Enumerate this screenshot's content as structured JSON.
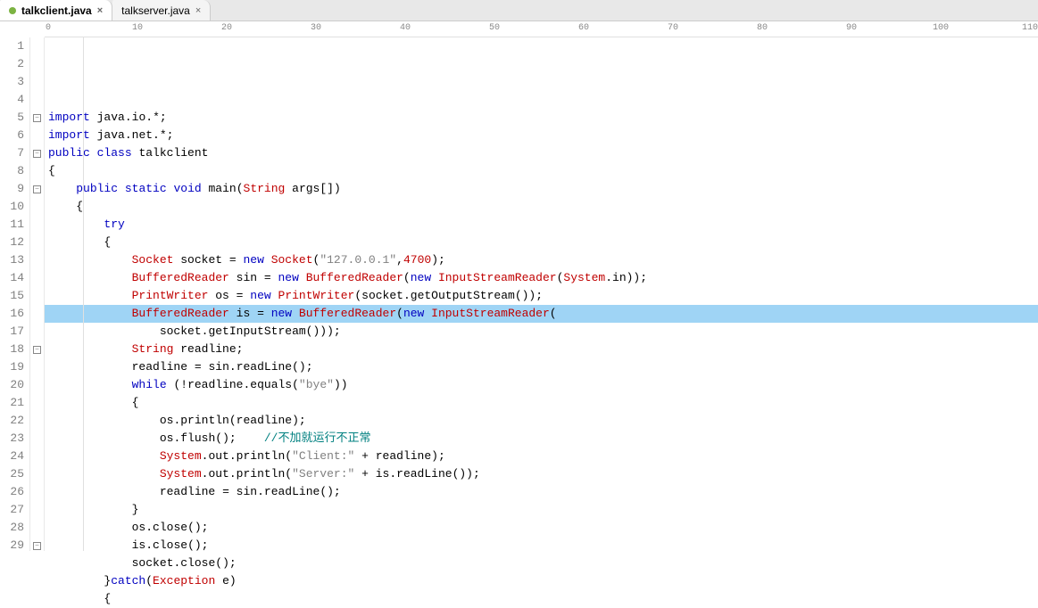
{
  "tabs": [
    {
      "label": "talkclient.java",
      "active": true,
      "modified": true
    },
    {
      "label": "talkserver.java",
      "active": false,
      "modified": false
    }
  ],
  "ruler": {
    "marks": [
      0,
      10,
      20,
      30,
      40,
      50,
      60,
      70,
      80,
      90,
      100,
      110
    ]
  },
  "code": {
    "lines": [
      {
        "n": 1,
        "fold": "",
        "hl": false,
        "tokens": []
      },
      {
        "n": 2,
        "fold": "",
        "hl": false,
        "tokens": [
          [
            "kw",
            "import"
          ],
          [
            "punc",
            " java"
          ],
          [
            "punc",
            "."
          ],
          [
            "ident",
            "io"
          ],
          [
            "punc",
            "."
          ],
          [
            "punc",
            "*"
          ],
          [
            "punc",
            ";"
          ]
        ]
      },
      {
        "n": 3,
        "fold": "",
        "hl": false,
        "tokens": [
          [
            "kw",
            "import"
          ],
          [
            "punc",
            " java"
          ],
          [
            "punc",
            "."
          ],
          [
            "ident",
            "net"
          ],
          [
            "punc",
            "."
          ],
          [
            "punc",
            "*"
          ],
          [
            "punc",
            ";"
          ]
        ]
      },
      {
        "n": 4,
        "fold": "",
        "hl": false,
        "tokens": [
          [
            "kw",
            "public"
          ],
          [
            "punc",
            " "
          ],
          [
            "kw",
            "class"
          ],
          [
            "punc",
            " "
          ],
          [
            "ident",
            "talkclient"
          ]
        ]
      },
      {
        "n": 5,
        "fold": "-",
        "hl": false,
        "tokens": [
          [
            "punc",
            "{"
          ]
        ]
      },
      {
        "n": 6,
        "fold": "",
        "hl": false,
        "tokens": [
          [
            "punc",
            "    "
          ],
          [
            "kw",
            "public"
          ],
          [
            "punc",
            " "
          ],
          [
            "kw",
            "static"
          ],
          [
            "punc",
            " "
          ],
          [
            "kw",
            "void"
          ],
          [
            "punc",
            " "
          ],
          [
            "ident",
            "main"
          ],
          [
            "punc",
            "("
          ],
          [
            "type",
            "String"
          ],
          [
            "punc",
            " args"
          ],
          [
            "punc",
            "[])"
          ]
        ]
      },
      {
        "n": 7,
        "fold": "-",
        "hl": false,
        "tokens": [
          [
            "punc",
            "    {"
          ]
        ]
      },
      {
        "n": 8,
        "fold": "",
        "hl": false,
        "tokens": [
          [
            "punc",
            "        "
          ],
          [
            "kw",
            "try"
          ]
        ]
      },
      {
        "n": 9,
        "fold": "-",
        "hl": false,
        "tokens": [
          [
            "punc",
            "        {"
          ]
        ]
      },
      {
        "n": 10,
        "fold": "",
        "hl": false,
        "tokens": [
          [
            "punc",
            "            "
          ],
          [
            "type",
            "Socket"
          ],
          [
            "punc",
            " socket "
          ],
          [
            "punc",
            "="
          ],
          [
            "punc",
            " "
          ],
          [
            "kw",
            "new"
          ],
          [
            "punc",
            " "
          ],
          [
            "type",
            "Socket"
          ],
          [
            "punc",
            "("
          ],
          [
            "str",
            "\"127.0.0.1\""
          ],
          [
            "punc",
            ","
          ],
          [
            "num",
            "4700"
          ],
          [
            "punc",
            ")"
          ],
          [
            "punc",
            ";"
          ]
        ]
      },
      {
        "n": 11,
        "fold": "",
        "hl": false,
        "tokens": [
          [
            "punc",
            "            "
          ],
          [
            "type",
            "BufferedReader"
          ],
          [
            "punc",
            " sin "
          ],
          [
            "punc",
            "="
          ],
          [
            "punc",
            " "
          ],
          [
            "kw",
            "new"
          ],
          [
            "punc",
            " "
          ],
          [
            "type",
            "BufferedReader"
          ],
          [
            "punc",
            "("
          ],
          [
            "kw",
            "new"
          ],
          [
            "punc",
            " "
          ],
          [
            "type",
            "InputStreamReader"
          ],
          [
            "punc",
            "("
          ],
          [
            "type",
            "System"
          ],
          [
            "punc",
            "."
          ],
          [
            "ident",
            "in"
          ],
          [
            "punc",
            "));"
          ]
        ]
      },
      {
        "n": 12,
        "fold": "",
        "hl": false,
        "tokens": [
          [
            "punc",
            "            "
          ],
          [
            "type",
            "PrintWriter"
          ],
          [
            "punc",
            " os "
          ],
          [
            "punc",
            "="
          ],
          [
            "punc",
            " "
          ],
          [
            "kw",
            "new"
          ],
          [
            "punc",
            " "
          ],
          [
            "type",
            "PrintWriter"
          ],
          [
            "punc",
            "("
          ],
          [
            "ident",
            "socket"
          ],
          [
            "punc",
            "."
          ],
          [
            "ident",
            "getOutputStream"
          ],
          [
            "punc",
            "());"
          ]
        ]
      },
      {
        "n": 13,
        "fold": "",
        "hl": true,
        "tokens": [
          [
            "punc",
            "            "
          ],
          [
            "type",
            "BufferedReader"
          ],
          [
            "punc",
            " is "
          ],
          [
            "punc",
            "="
          ],
          [
            "punc",
            " "
          ],
          [
            "kw",
            "new"
          ],
          [
            "punc",
            " "
          ],
          [
            "type",
            "BufferedReader"
          ],
          [
            "punc",
            "("
          ],
          [
            "kw",
            "new"
          ],
          [
            "punc",
            " "
          ],
          [
            "type",
            "InputStreamReader"
          ],
          [
            "punc",
            "("
          ]
        ]
      },
      {
        "n": 14,
        "fold": "",
        "hl": false,
        "tokens": [
          [
            "punc",
            "                "
          ],
          [
            "ident",
            "socket"
          ],
          [
            "punc",
            "."
          ],
          [
            "ident",
            "getInputStream"
          ],
          [
            "punc",
            "()));"
          ]
        ]
      },
      {
        "n": 15,
        "fold": "",
        "hl": false,
        "tokens": [
          [
            "punc",
            "            "
          ],
          [
            "type",
            "String"
          ],
          [
            "punc",
            " readline;"
          ]
        ]
      },
      {
        "n": 16,
        "fold": "",
        "hl": false,
        "tokens": [
          [
            "punc",
            "            "
          ],
          [
            "ident",
            "readline"
          ],
          [
            "punc",
            " "
          ],
          [
            "punc",
            "="
          ],
          [
            "punc",
            " sin"
          ],
          [
            "punc",
            "."
          ],
          [
            "ident",
            "readLine"
          ],
          [
            "punc",
            "();"
          ]
        ]
      },
      {
        "n": 17,
        "fold": "",
        "hl": false,
        "tokens": [
          [
            "punc",
            "            "
          ],
          [
            "kw",
            "while"
          ],
          [
            "punc",
            " ("
          ],
          [
            "punc",
            "!"
          ],
          [
            "ident",
            "readline"
          ],
          [
            "punc",
            "."
          ],
          [
            "ident",
            "equals"
          ],
          [
            "punc",
            "("
          ],
          [
            "str",
            "\"bye\""
          ],
          [
            "punc",
            "))"
          ]
        ]
      },
      {
        "n": 18,
        "fold": "-",
        "hl": false,
        "tokens": [
          [
            "punc",
            "            {"
          ]
        ]
      },
      {
        "n": 19,
        "fold": "",
        "hl": false,
        "tokens": [
          [
            "punc",
            "                "
          ],
          [
            "ident",
            "os"
          ],
          [
            "punc",
            "."
          ],
          [
            "ident",
            "println"
          ],
          [
            "punc",
            "("
          ],
          [
            "ident",
            "readline"
          ],
          [
            "punc",
            ")"
          ],
          [
            "punc",
            ";"
          ]
        ]
      },
      {
        "n": 20,
        "fold": "",
        "hl": false,
        "cursor": true,
        "tokens": [
          [
            "punc",
            "                "
          ],
          [
            "ident",
            "os"
          ],
          [
            "punc",
            "."
          ],
          [
            "ident",
            "flush"
          ],
          [
            "punc",
            "();    "
          ],
          [
            "cmt",
            "//不加就运行不正常"
          ]
        ]
      },
      {
        "n": 21,
        "fold": "",
        "hl": false,
        "tokens": [
          [
            "punc",
            "                "
          ],
          [
            "type",
            "System"
          ],
          [
            "punc",
            "."
          ],
          [
            "ident",
            "out"
          ],
          [
            "punc",
            "."
          ],
          [
            "ident",
            "println"
          ],
          [
            "punc",
            "("
          ],
          [
            "str",
            "\"Client:\""
          ],
          [
            "punc",
            " "
          ],
          [
            "punc",
            "+"
          ],
          [
            "punc",
            " readline);"
          ]
        ]
      },
      {
        "n": 22,
        "fold": "",
        "hl": false,
        "tokens": [
          [
            "punc",
            "                "
          ],
          [
            "type",
            "System"
          ],
          [
            "punc",
            "."
          ],
          [
            "ident",
            "out"
          ],
          [
            "punc",
            "."
          ],
          [
            "ident",
            "println"
          ],
          [
            "punc",
            "("
          ],
          [
            "str",
            "\"Server:\""
          ],
          [
            "punc",
            " "
          ],
          [
            "punc",
            "+"
          ],
          [
            "punc",
            " is"
          ],
          [
            "punc",
            "."
          ],
          [
            "ident",
            "readLine"
          ],
          [
            "punc",
            "());"
          ]
        ]
      },
      {
        "n": 23,
        "fold": "",
        "hl": false,
        "tokens": [
          [
            "punc",
            "                "
          ],
          [
            "ident",
            "readline"
          ],
          [
            "punc",
            " "
          ],
          [
            "punc",
            "="
          ],
          [
            "punc",
            " sin"
          ],
          [
            "punc",
            "."
          ],
          [
            "ident",
            "readLine"
          ],
          [
            "punc",
            "();"
          ]
        ]
      },
      {
        "n": 24,
        "fold": "",
        "hl": false,
        "tokens": [
          [
            "punc",
            "            }"
          ]
        ]
      },
      {
        "n": 25,
        "fold": "",
        "hl": false,
        "tokens": [
          [
            "punc",
            "            "
          ],
          [
            "ident",
            "os"
          ],
          [
            "punc",
            "."
          ],
          [
            "ident",
            "close"
          ],
          [
            "punc",
            "();"
          ]
        ]
      },
      {
        "n": 26,
        "fold": "",
        "hl": false,
        "tokens": [
          [
            "punc",
            "            "
          ],
          [
            "ident",
            "is"
          ],
          [
            "punc",
            "."
          ],
          [
            "ident",
            "close"
          ],
          [
            "punc",
            "();"
          ]
        ]
      },
      {
        "n": 27,
        "fold": "",
        "hl": false,
        "tokens": [
          [
            "punc",
            "            "
          ],
          [
            "ident",
            "socket"
          ],
          [
            "punc",
            "."
          ],
          [
            "ident",
            "close"
          ],
          [
            "punc",
            "();"
          ]
        ]
      },
      {
        "n": 28,
        "fold": "",
        "hl": false,
        "tokens": [
          [
            "punc",
            "        }"
          ],
          [
            "kw",
            "catch"
          ],
          [
            "punc",
            "("
          ],
          [
            "type",
            "Exception"
          ],
          [
            "punc",
            " e)"
          ]
        ]
      },
      {
        "n": 29,
        "fold": "-",
        "hl": false,
        "tokens": [
          [
            "punc",
            "        {"
          ]
        ]
      }
    ]
  }
}
